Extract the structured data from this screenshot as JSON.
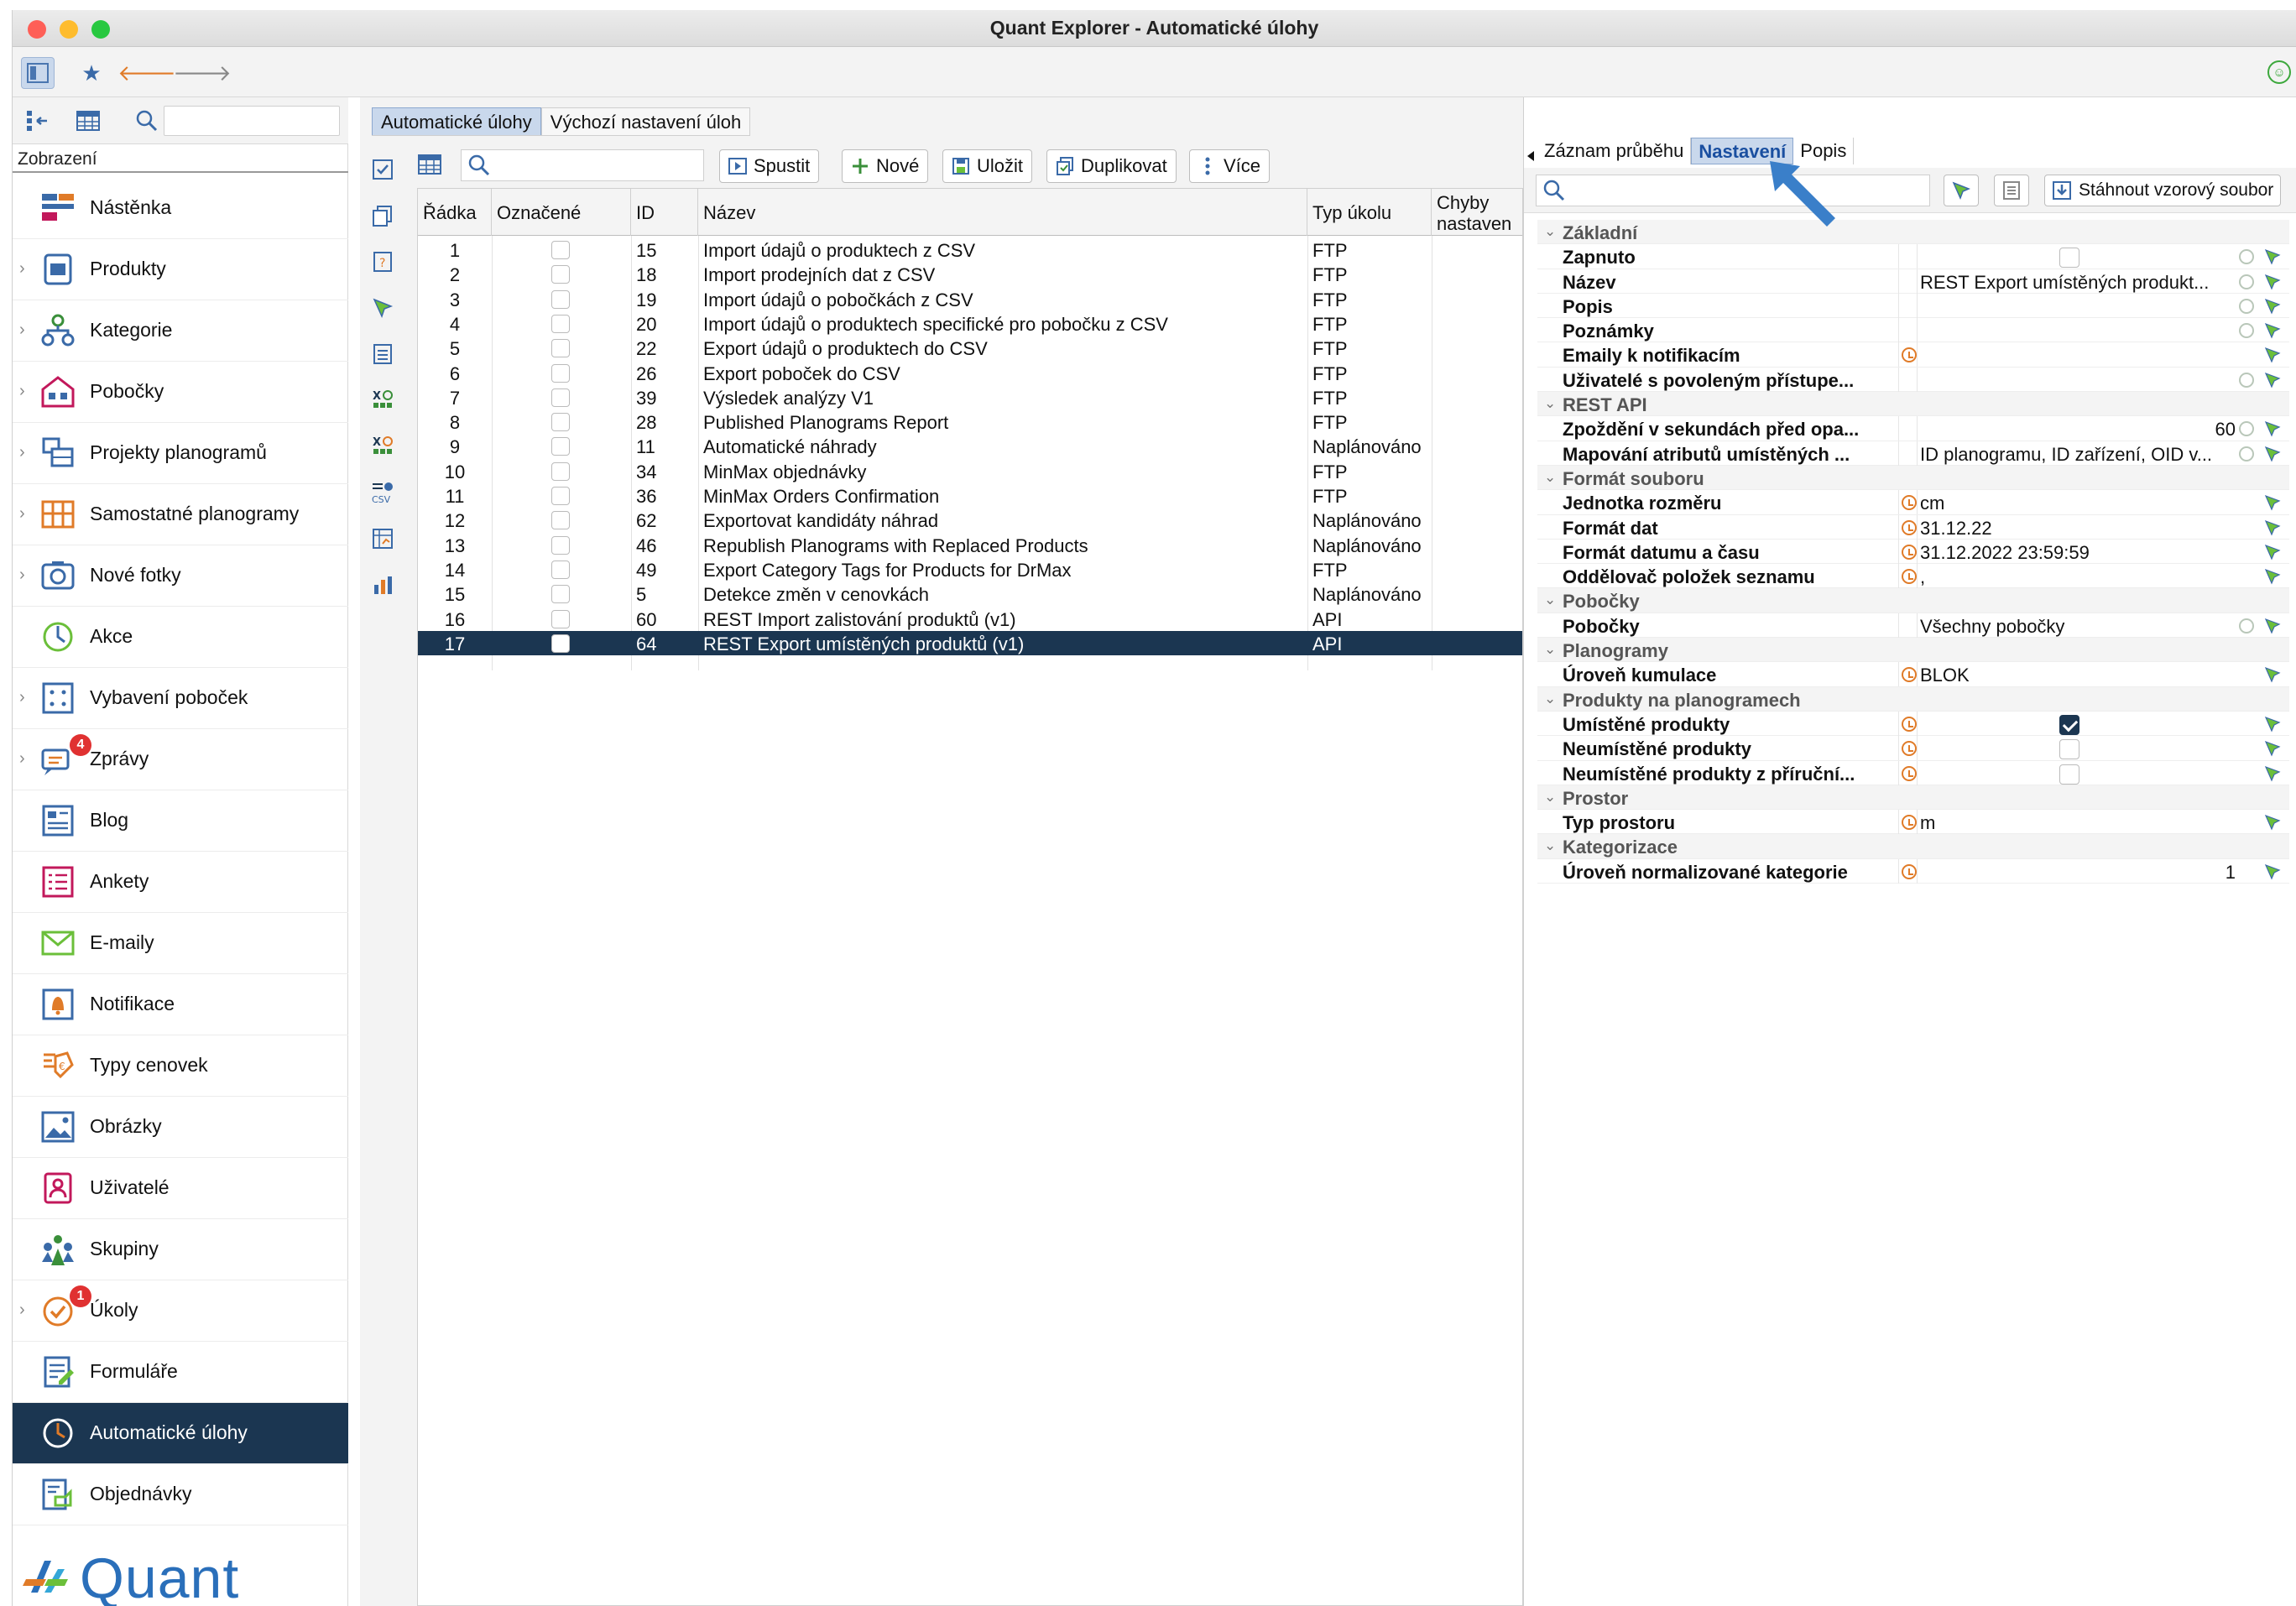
{
  "window": {
    "title": "Quant Explorer - Automatické úlohy"
  },
  "left": {
    "section_label": "Zobrazení",
    "items": [
      {
        "label": "Nástěnka",
        "icon": "dashboard-icon",
        "chevron": false,
        "badge": ""
      },
      {
        "label": "Produkty",
        "icon": "products-icon",
        "chevron": true,
        "badge": ""
      },
      {
        "label": "Kategorie",
        "icon": "categories-icon",
        "chevron": true,
        "badge": ""
      },
      {
        "label": "Pobočky",
        "icon": "stores-icon",
        "chevron": true,
        "badge": ""
      },
      {
        "label": "Projekty planogramů",
        "icon": "planogram-projects-icon",
        "chevron": true,
        "badge": ""
      },
      {
        "label": "Samostatné planogramy",
        "icon": "planograms-icon",
        "chevron": true,
        "badge": ""
      },
      {
        "label": "Nové fotky",
        "icon": "camera-icon",
        "chevron": true,
        "badge": ""
      },
      {
        "label": "Akce",
        "icon": "actions-icon",
        "chevron": false,
        "badge": ""
      },
      {
        "label": "Vybavení poboček",
        "icon": "equipment-icon",
        "chevron": true,
        "badge": ""
      },
      {
        "label": "Zprávy",
        "icon": "messages-icon",
        "chevron": true,
        "badge": "4"
      },
      {
        "label": "Blog",
        "icon": "blog-icon",
        "chevron": false,
        "badge": ""
      },
      {
        "label": "Ankety",
        "icon": "surveys-icon",
        "chevron": false,
        "badge": ""
      },
      {
        "label": "E-maily",
        "icon": "email-icon",
        "chevron": false,
        "badge": ""
      },
      {
        "label": "Notifikace",
        "icon": "notification-icon",
        "chevron": false,
        "badge": ""
      },
      {
        "label": "Typy cenovek",
        "icon": "price-tag-icon",
        "chevron": false,
        "badge": ""
      },
      {
        "label": "Obrázky",
        "icon": "image-icon",
        "chevron": false,
        "badge": ""
      },
      {
        "label": "Uživatelé",
        "icon": "user-icon",
        "chevron": false,
        "badge": ""
      },
      {
        "label": "Skupiny",
        "icon": "groups-icon",
        "chevron": false,
        "badge": ""
      },
      {
        "label": "Úkoly",
        "icon": "tasks-icon",
        "chevron": true,
        "badge": "1"
      },
      {
        "label": "Formuláře",
        "icon": "forms-icon",
        "chevron": false,
        "badge": ""
      },
      {
        "label": "Automatické úlohy",
        "icon": "scheduled-tasks-icon",
        "chevron": false,
        "badge": "",
        "selected": true
      },
      {
        "label": "Objednávky",
        "icon": "orders-icon",
        "chevron": false,
        "badge": ""
      }
    ],
    "logo_text": "Quant"
  },
  "center": {
    "tabs": [
      {
        "label": "Automatické úlohy",
        "active": true
      },
      {
        "label": "Výchozí nastavení úloh",
        "active": false
      }
    ],
    "buttons": {
      "run": "Spustit",
      "new": "Nové",
      "save": "Uložit",
      "duplicate": "Duplikovat",
      "more": "Více"
    },
    "columns": {
      "row": "Řádka",
      "marked": "Označené",
      "id": "ID",
      "name": "Název",
      "type": "Typ úkolu",
      "errors": "Chyby nastaven"
    },
    "rows": [
      {
        "row": "1",
        "id": "15",
        "name": "Import údajů o produktech z CSV",
        "type": "FTP"
      },
      {
        "row": "2",
        "id": "18",
        "name": "Import prodejních dat z CSV",
        "type": "FTP"
      },
      {
        "row": "3",
        "id": "19",
        "name": "Import údajů o pobočkách z CSV",
        "type": "FTP"
      },
      {
        "row": "4",
        "id": "20",
        "name": "Import údajů o produktech specifické pro pobočku z CSV",
        "type": "FTP"
      },
      {
        "row": "5",
        "id": "22",
        "name": "Export údajů o produktech do CSV",
        "type": "FTP"
      },
      {
        "row": "6",
        "id": "26",
        "name": "Export poboček do CSV",
        "type": "FTP"
      },
      {
        "row": "7",
        "id": "39",
        "name": "Výsledek analýzy V1",
        "type": "FTP"
      },
      {
        "row": "8",
        "id": "28",
        "name": "Published Planograms Report",
        "type": "FTP"
      },
      {
        "row": "9",
        "id": "11",
        "name": "Automatické náhrady",
        "type": "Naplánováno"
      },
      {
        "row": "10",
        "id": "34",
        "name": "MinMax objednávky",
        "type": "FTP"
      },
      {
        "row": "11",
        "id": "36",
        "name": "MinMax Orders Confirmation",
        "type": "FTP"
      },
      {
        "row": "12",
        "id": "62",
        "name": "Exportovat kandidáty náhrad",
        "type": "Naplánováno"
      },
      {
        "row": "13",
        "id": "46",
        "name": "Republish Planograms with Replaced Products",
        "type": "Naplánováno"
      },
      {
        "row": "14",
        "id": "49",
        "name": "Export Category Tags for Products for DrMax",
        "type": "FTP"
      },
      {
        "row": "15",
        "id": "5",
        "name": "Detekce změn v cenovkách",
        "type": "Naplánováno"
      },
      {
        "row": "16",
        "id": "60",
        "name": "REST Import zalistování produktů (v1)",
        "type": "API"
      },
      {
        "row": "17",
        "id": "64",
        "name": "REST Export umístěných produktů (v1)",
        "type": "API",
        "selected": true
      }
    ]
  },
  "right": {
    "tabs": [
      {
        "label": "Záznam průběhu",
        "active": false
      },
      {
        "label": "Nastavení",
        "active": true
      },
      {
        "label": "Popis",
        "active": false
      }
    ],
    "download_label": "Stáhnout vzorový soubor",
    "properties": [
      {
        "kind": "section",
        "label": "Základní"
      },
      {
        "kind": "prop",
        "label": "Zapnuto",
        "value": "",
        "checkbox": "off",
        "orange": false,
        "green": true
      },
      {
        "kind": "prop",
        "label": "Název",
        "value": "REST Export umístěných produkt...",
        "orange": false,
        "green": true
      },
      {
        "kind": "prop",
        "label": "Popis",
        "value": "",
        "orange": false,
        "green": true
      },
      {
        "kind": "prop",
        "label": "Poznámky",
        "value": "",
        "orange": false,
        "green": true
      },
      {
        "kind": "prop",
        "label": "Emaily k notifikacím",
        "value": "",
        "orange": true,
        "green": false
      },
      {
        "kind": "prop",
        "label": "Uživatelé s povoleným přístupe...",
        "value": "",
        "orange": false,
        "green": true
      },
      {
        "kind": "section",
        "label": "REST API"
      },
      {
        "kind": "prop",
        "label": "Zpoždění v sekundách před opa...",
        "value": "60",
        "num": true,
        "orange": false,
        "green": true
      },
      {
        "kind": "prop",
        "label": "Mapování atributů umístěných ...",
        "value": "ID planogramu, ID zařízení, OID v...",
        "orange": false,
        "green": true
      },
      {
        "kind": "section",
        "label": "Formát souboru"
      },
      {
        "kind": "prop",
        "label": "Jednotka rozměru",
        "value": "cm",
        "orange": true,
        "green": false
      },
      {
        "kind": "prop",
        "label": "Formát dat",
        "value": "31.12.22",
        "orange": true,
        "green": false
      },
      {
        "kind": "prop",
        "label": "Formát datumu a času",
        "value": "31.12.2022 23:59:59",
        "orange": true,
        "green": false
      },
      {
        "kind": "prop",
        "label": "Oddělovač položek seznamu",
        "value": ",",
        "orange": true,
        "green": false
      },
      {
        "kind": "section",
        "label": "Pobočky"
      },
      {
        "kind": "prop",
        "label": "Pobočky",
        "value": "Všechny pobočky",
        "orange": false,
        "green": true
      },
      {
        "kind": "section",
        "label": "Planogramy"
      },
      {
        "kind": "prop",
        "label": "Úroveň kumulace",
        "value": "BLOK",
        "orange": true,
        "green": false
      },
      {
        "kind": "section",
        "label": "Produkty na planogramech"
      },
      {
        "kind": "prop",
        "label": "Umístěné produkty",
        "value": "",
        "checkbox": "on",
        "orange": true,
        "green": false
      },
      {
        "kind": "prop",
        "label": "Neumístěné produkty",
        "value": "",
        "checkbox": "off",
        "orange": true,
        "green": false
      },
      {
        "kind": "prop",
        "label": "Neumístěné produkty z příruční...",
        "value": "",
        "checkbox": "off",
        "orange": true,
        "green": false
      },
      {
        "kind": "section",
        "label": "Prostor"
      },
      {
        "kind": "prop",
        "label": "Typ prostoru",
        "value": "m",
        "orange": true,
        "green": false
      },
      {
        "kind": "section",
        "label": "Kategorizace"
      },
      {
        "kind": "prop",
        "label": "Úroveň normalizované kategorie",
        "value": "1",
        "num": true,
        "orange": true,
        "green": false
      }
    ]
  },
  "colors": {
    "selected": "#1b3651",
    "accent": "#2a6fba",
    "orange": "#e07b28",
    "badge": "#e03131"
  }
}
